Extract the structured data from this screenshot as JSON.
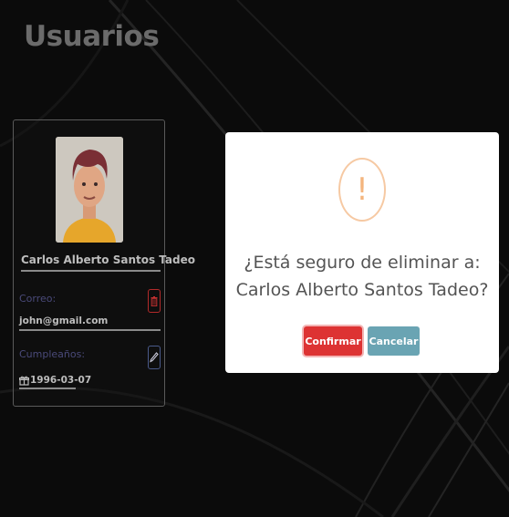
{
  "page": {
    "title": "Usuarios"
  },
  "user_card": {
    "name": "Carlos Alberto Santos Tadeo",
    "email_label": "Correo:",
    "email": "john@gmail.com",
    "birthday_label": "Cumpleaños:",
    "birthday": "1996-03-07",
    "icons": {
      "delete": "trash-icon",
      "edit": "pencil-icon",
      "birthday": "gift-icon"
    }
  },
  "modal": {
    "icon": "exclamation-icon",
    "icon_glyph": "!",
    "line1": "¿Está seguro de eliminar a:",
    "line2": "Carlos Alberto Santos Tadeo?",
    "confirm_label": "Confirmar",
    "cancel_label": "Cancelar"
  },
  "colors": {
    "confirm": "#dd3333",
    "cancel": "#6aa4b3",
    "warning": "#f4b57e",
    "backdrop": "#0b0b0b"
  }
}
